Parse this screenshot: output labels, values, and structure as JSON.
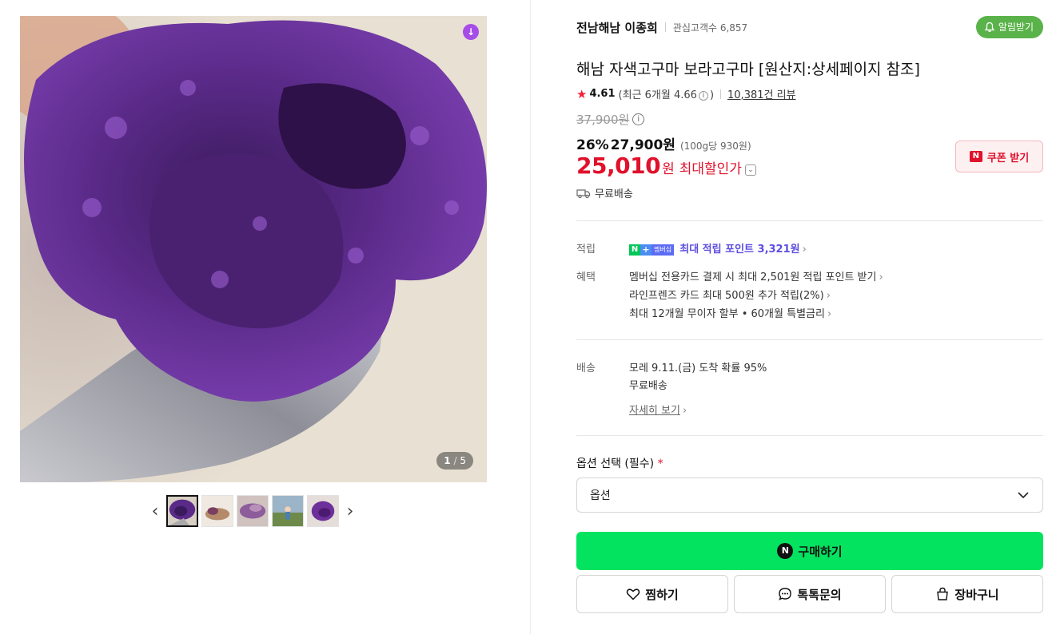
{
  "gallery": {
    "counter_current": "1",
    "counter_sep": "/",
    "counter_total": "5",
    "download_icon": "arrow-down-icon",
    "prev_icon": "chevron-left-icon",
    "next_icon": "chevron-right-icon",
    "thumb_count": 5
  },
  "store": {
    "name": "전남해남 이종희",
    "fans": "관심고객수 6,857",
    "alarm_label": "알림받기"
  },
  "product": {
    "title": "해남 자색고구마 보라고구마 [원산지:상세페이지 참조]",
    "rating": "4.61",
    "recent_prefix": "(최근 6개월 4.66",
    "recent_suffix": ")",
    "review_count": "10,381건 리뷰",
    "original_price": "37,900원",
    "discount_pct": "26%",
    "sale_price": "27,900원",
    "unit_price": "(100g당 930원)",
    "max_price_num": "25,010",
    "max_price_unit": "원",
    "max_label": "최대할인가",
    "coupon_label": "쿠폰 받기",
    "free_shipping": "무료배송"
  },
  "benefits": {
    "points_label": "적립",
    "membership_badge": "멤버십",
    "points_text": "최대 적립 포인트 3,321원",
    "perks_label": "혜택",
    "perks": [
      "멤버십 전용카드 결제 시 최대 2,501원 적립 포인트 받기",
      "라인프렌즈 카드 최대 500원 추가 적립(2%)",
      "최대 12개월 무이자 할부 • 60개월 특별금리"
    ]
  },
  "delivery": {
    "label": "배송",
    "arrival": "모레 9.11.(금) 도착 확률 95%",
    "fee": "무료배송",
    "more": "자세히 보기"
  },
  "options": {
    "title": "옵션 선택 (필수)",
    "required_mark": "*",
    "placeholder": "옵션"
  },
  "actions": {
    "buy": "구매하기",
    "wish": "찜하기",
    "talk": "톡톡문의",
    "cart": "장바구니"
  },
  "colors": {
    "accent_green": "#03e35f",
    "sale_red": "#e0112b",
    "alarm_green": "#5ab34a",
    "points_purple": "#5d4de0"
  }
}
